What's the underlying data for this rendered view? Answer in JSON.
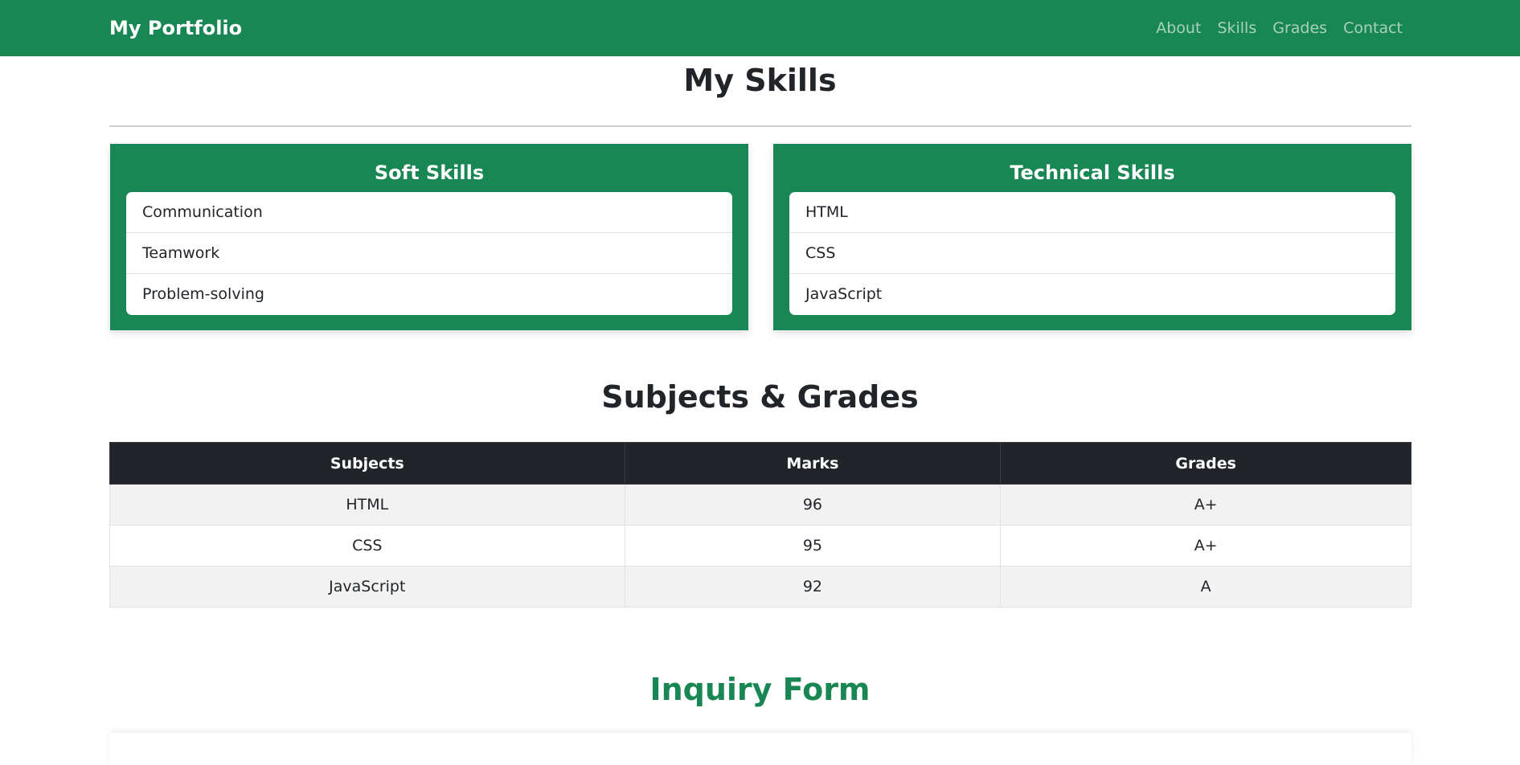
{
  "nav": {
    "brand": "My Portfolio",
    "links": [
      "About",
      "Skills",
      "Grades",
      "Contact"
    ]
  },
  "skills": {
    "title": "My Skills",
    "soft": {
      "title": "Soft Skills",
      "items": [
        "Communication",
        "Teamwork",
        "Problem-solving"
      ]
    },
    "technical": {
      "title": "Technical Skills",
      "items": [
        "HTML",
        "CSS",
        "JavaScript"
      ]
    }
  },
  "grades": {
    "title": "Subjects & Grades",
    "headers": [
      "Subjects",
      "Marks",
      "Grades"
    ],
    "rows": [
      [
        "HTML",
        "96",
        "A+"
      ],
      [
        "CSS",
        "95",
        "A+"
      ],
      [
        "JavaScript",
        "92",
        "A"
      ]
    ]
  },
  "inquiry": {
    "title": "Inquiry Form"
  },
  "colors": {
    "accent": "#198754",
    "table_header": "#212529",
    "striped_row": "#f2f2f2"
  }
}
